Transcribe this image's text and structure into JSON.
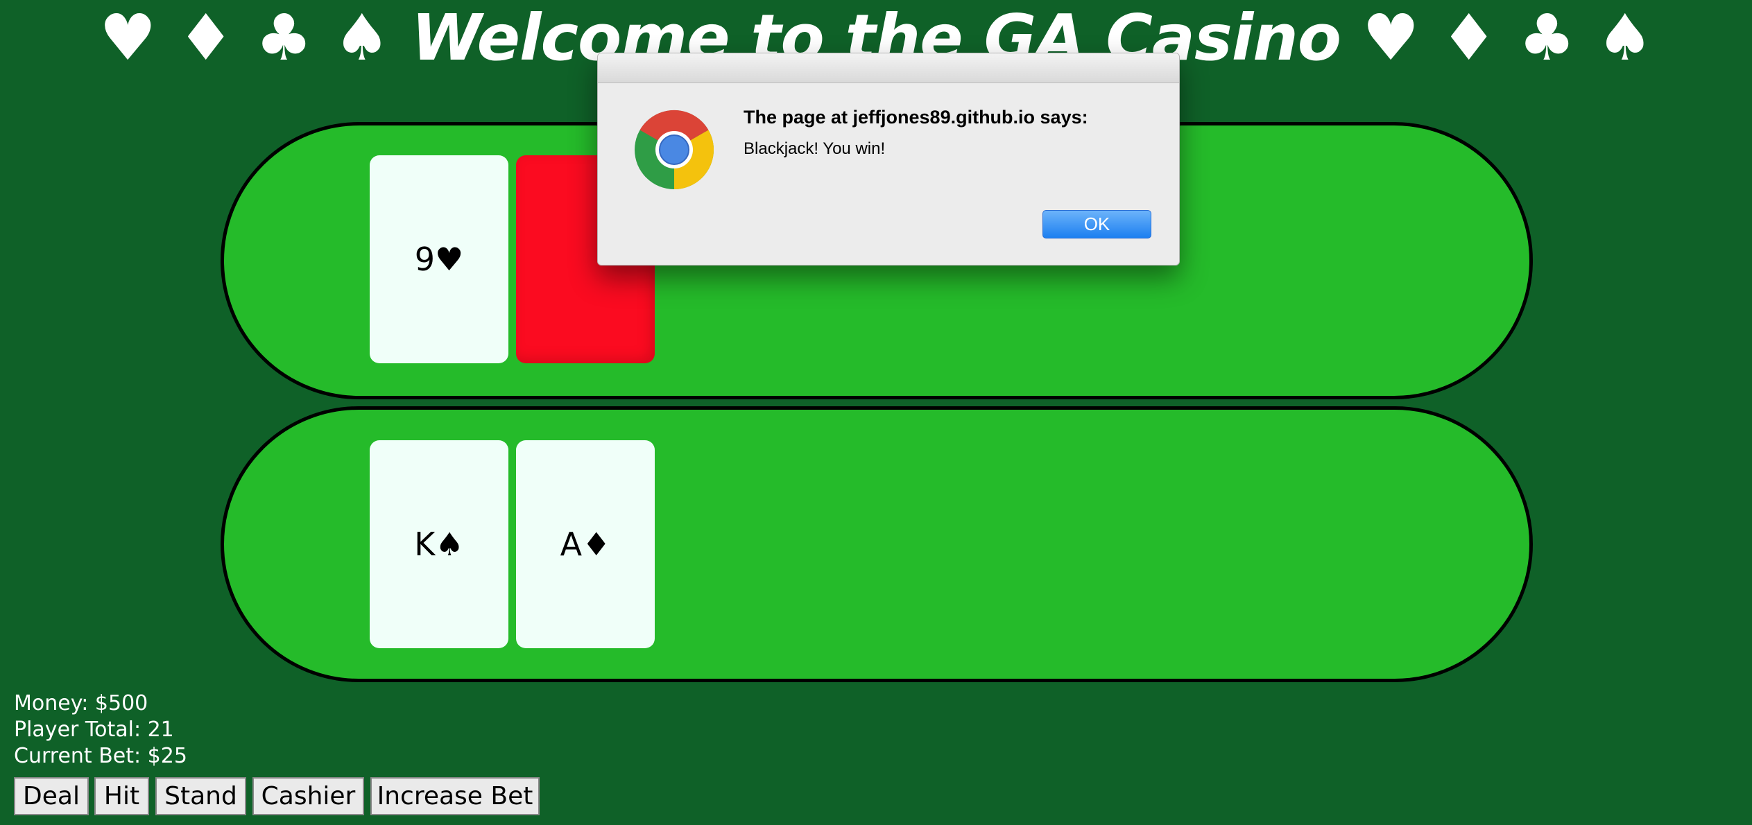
{
  "header": {
    "title": "♥ ♦ ♣ ♠ Welcome to the GA Casino ♥ ♦ ♣ ♠"
  },
  "dealer": {
    "cards": [
      {
        "label": "9♥",
        "face_up": true
      },
      {
        "label": "",
        "face_up": false
      }
    ]
  },
  "player": {
    "cards": [
      {
        "label": "K♠",
        "face_up": true
      },
      {
        "label": "A♦",
        "face_up": true
      }
    ]
  },
  "stats": {
    "money": "Money: $500",
    "player_total": "Player Total: 21",
    "current_bet": "Current Bet: $25"
  },
  "controls": {
    "deal": "Deal",
    "hit": "Hit",
    "stand": "Stand",
    "cashier": "Cashier",
    "increase_bet": "Increase Bet"
  },
  "alert": {
    "heading": "The page at jeffjones89.github.io says:",
    "message": "Blackjack! You win!",
    "ok_label": "OK"
  },
  "colors": {
    "page_background": "#0f6128",
    "table_felt": "#25bb2a",
    "card_face": "#f0fff9",
    "card_back": "#fb0b20",
    "ok_button": "#1c7ff0"
  },
  "icons": {
    "alert_icon": "chrome-logo-icon"
  }
}
